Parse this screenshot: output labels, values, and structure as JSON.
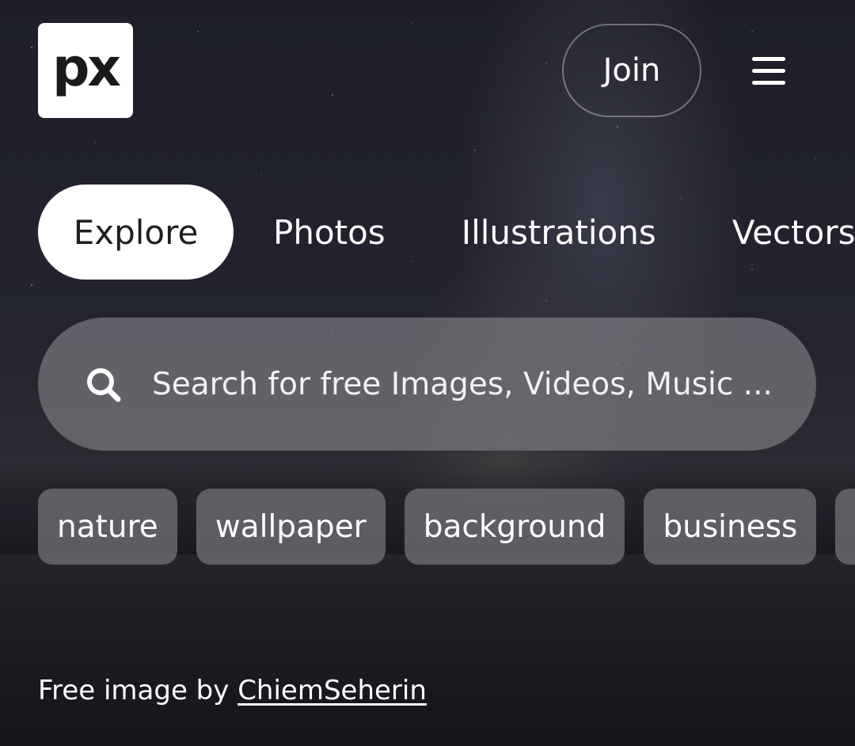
{
  "brand": {
    "logo_text": "px"
  },
  "header": {
    "join_label": "Join",
    "menu_icon": "hamburger-menu-icon"
  },
  "tabs": [
    {
      "label": "Explore",
      "active": true
    },
    {
      "label": "Photos",
      "active": false
    },
    {
      "label": "Illustrations",
      "active": false
    },
    {
      "label": "Vectors",
      "active": false
    }
  ],
  "search": {
    "icon": "search-icon",
    "placeholder": "Search for free Images, Videos, Music ...",
    "value": ""
  },
  "chips": [
    {
      "label": "nature"
    },
    {
      "label": "wallpaper"
    },
    {
      "label": "background"
    },
    {
      "label": "business"
    }
  ],
  "credit": {
    "prefix": "Free image by ",
    "author": "ChiemSeherin"
  },
  "colors": {
    "tab_active_bg": "#ffffff",
    "search_bg": "#78787e",
    "chip_bg": "#707076"
  }
}
